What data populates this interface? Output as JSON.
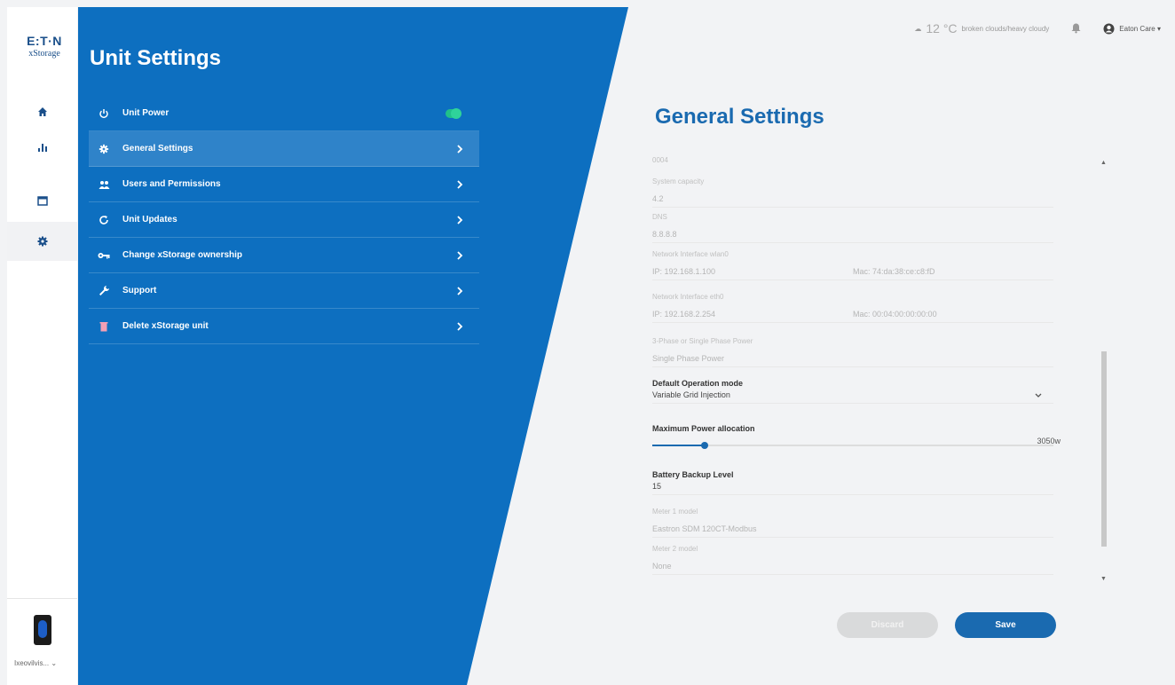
{
  "brand": {
    "name": "E:T·N",
    "product": "xStorage"
  },
  "rail": {
    "items": [
      {
        "icon": "home-icon"
      },
      {
        "icon": "chart-icon"
      },
      {
        "icon": "calendar-icon"
      },
      {
        "icon": "gear-icon",
        "active": true
      }
    ],
    "device_name": "Ixeovilvis... ⌄"
  },
  "panel": {
    "title": "Unit Settings",
    "menu": [
      {
        "label": "Unit Power",
        "icon": "power-icon",
        "toggle": true
      },
      {
        "label": "General Settings",
        "icon": "gear-icon",
        "active": true
      },
      {
        "label": "Users and Permissions",
        "icon": "users-icon"
      },
      {
        "label": "Unit Updates",
        "icon": "refresh-icon"
      },
      {
        "label": "Change xStorage ownership",
        "icon": "key-icon"
      },
      {
        "label": "Support",
        "icon": "wrench-icon"
      },
      {
        "label": "Delete xStorage unit",
        "icon": "trash-icon"
      }
    ]
  },
  "topbar": {
    "temperature": "12 °C",
    "weather_desc": "broken clouds/heavy cloudy",
    "user": "Eaton Care ▾"
  },
  "settings": {
    "title": "General Settings",
    "fields": {
      "f1_label": "0004",
      "f2_label": "System capacity",
      "f2_value": "4.2",
      "f3_label": "DNS",
      "f3_value": "8.8.8.8",
      "f4_label": "Network Interface wlan0",
      "f4_ip": "IP: 192.168.1.100",
      "f4_mac": "Mac: 74:da:38:ce:c8:fD",
      "f5_label": "Network Interface eth0",
      "f5_ip": "IP: 192.168.2.254",
      "f5_mac": "Mac: 00:04:00:00:00:00",
      "f6_label": "3-Phase or Single Phase Power",
      "f6_value": "Single Phase Power",
      "f7_label": "Default Operation mode",
      "f7_value": "Variable Grid Injection",
      "f8_label": "Maximum Power allocation",
      "f8_value": "3050w",
      "f8_fraction": 0.13,
      "f9_label": "Battery Backup Level",
      "f9_value": "15",
      "f10_label": "Meter 1 model",
      "f10_value": "Eastron SDM 120CT-Modbus",
      "f11_label": "Meter 2 model",
      "f11_value": "None"
    },
    "discard_label": "Discard",
    "save_label": "Save"
  },
  "colors": {
    "accent": "#1a6ab0",
    "panel": "#0d6fc0",
    "toggle": "#20c08a"
  }
}
